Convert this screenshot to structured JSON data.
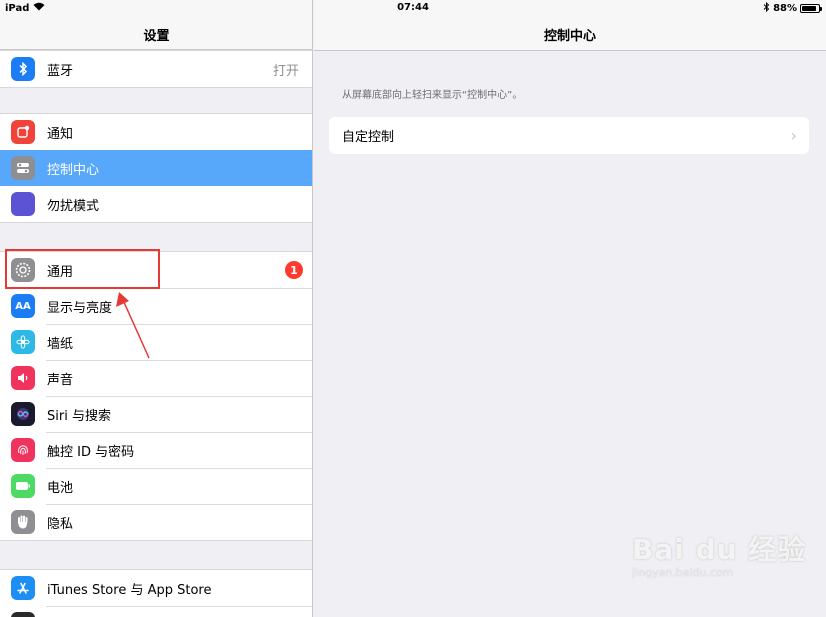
{
  "statusbar": {
    "device": "iPad",
    "time": "07:44",
    "battery": "88%",
    "battery_level": 0.88
  },
  "left": {
    "title": "设置",
    "groups": [
      [
        {
          "label": "蓝牙",
          "value": "打开",
          "icon": "bluetooth-icon",
          "color": "#1c7cf4"
        }
      ],
      [
        {
          "label": "通知",
          "icon": "notifications-icon",
          "color": "#f0433a"
        },
        {
          "label": "控制中心",
          "icon": "control-center-icon",
          "color": "#8e8e93",
          "selected": true
        },
        {
          "label": "勿扰模式",
          "icon": "moon-icon",
          "color": "#5b53d4"
        }
      ],
      [
        {
          "label": "通用",
          "icon": "gear-icon",
          "color": "#8e8e93",
          "badge": "1"
        },
        {
          "label": "显示与亮度",
          "icon": "text-size-icon",
          "color": "#1c7cf4"
        },
        {
          "label": "墙纸",
          "icon": "wallpaper-icon",
          "color": "#2eb8e6"
        },
        {
          "label": "声音",
          "icon": "speaker-icon",
          "color": "#f0335c"
        },
        {
          "label": "Siri 与搜索",
          "icon": "siri-icon",
          "color": "#1a1a2e"
        },
        {
          "label": "触控 ID 与密码",
          "icon": "fingerprint-icon",
          "color": "#f0335c"
        },
        {
          "label": "电池",
          "icon": "battery-icon",
          "color": "#4cd964"
        },
        {
          "label": "隐私",
          "icon": "hand-icon",
          "color": "#8e8e93"
        }
      ],
      [
        {
          "label": "iTunes Store 与 App Store",
          "icon": "app-store-icon",
          "color": "#1c8ef4"
        }
      ]
    ]
  },
  "right": {
    "title": "控制中心",
    "hint": "从屏幕底部向上轻扫来显示“控制中心”。",
    "customize_label": "自定控制"
  },
  "watermark": {
    "main": "Bai du 经验",
    "sub": "jingyan.baidu.com"
  }
}
